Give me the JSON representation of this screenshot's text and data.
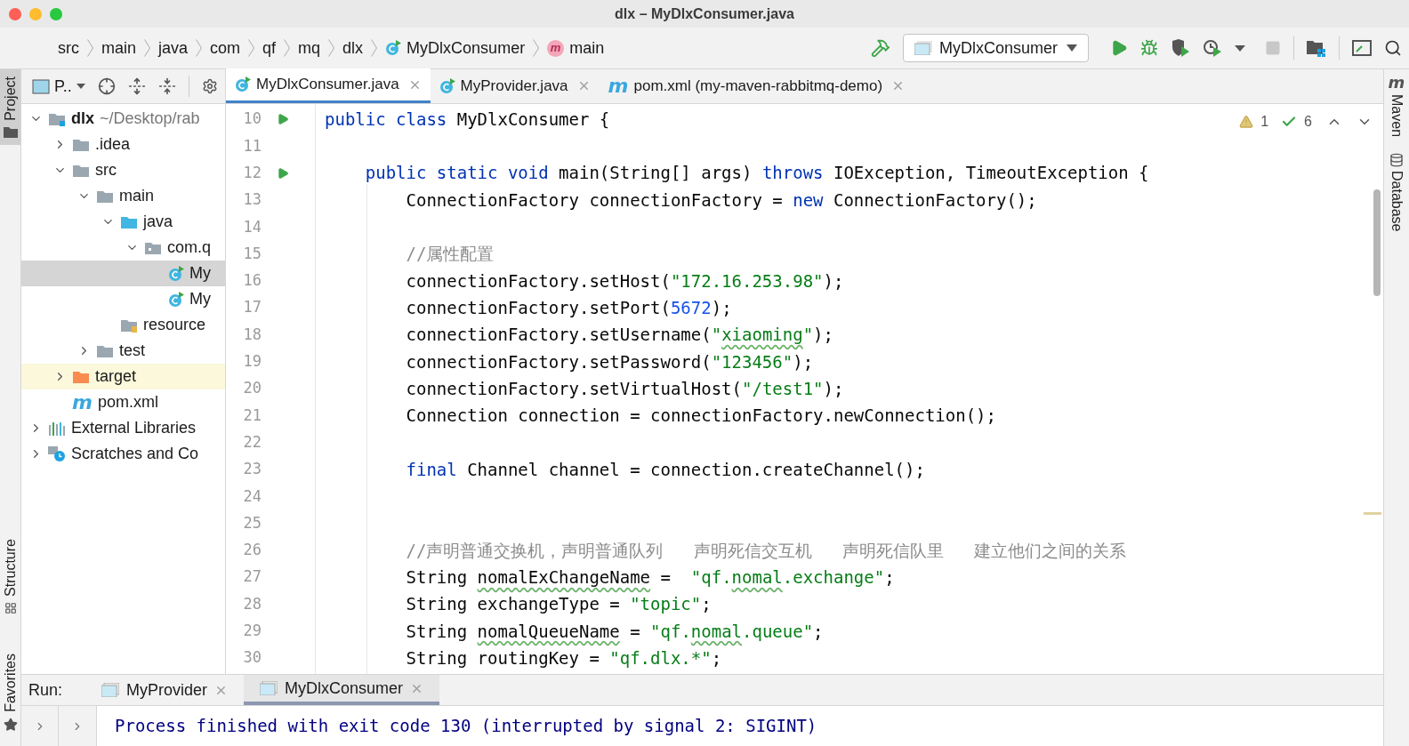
{
  "window": {
    "title": "dlx – MyDlxConsumer.java"
  },
  "breadcrumbs": [
    {
      "label": "src",
      "kind": "plain"
    },
    {
      "label": "main",
      "kind": "plain"
    },
    {
      "label": "java",
      "kind": "plain"
    },
    {
      "label": "com",
      "kind": "plain"
    },
    {
      "label": "qf",
      "kind": "plain"
    },
    {
      "label": "mq",
      "kind": "plain"
    },
    {
      "label": "dlx",
      "kind": "plain"
    },
    {
      "label": "MyDlxConsumer",
      "kind": "class"
    },
    {
      "label": "main",
      "kind": "method",
      "glyph": "m"
    }
  ],
  "run_config": {
    "label": "MyDlxConsumer"
  },
  "project_panel": {
    "view_label": "P..",
    "tree": [
      {
        "name": "dlx",
        "detail": "~/Desktop/rab",
        "kind": "module",
        "expanded": true,
        "selected": false,
        "children": [
          {
            "name": ".idea",
            "kind": "folder",
            "expanded": false,
            "selected": false
          },
          {
            "name": "src",
            "kind": "folder",
            "expanded": true,
            "selected": false,
            "children": [
              {
                "name": "main",
                "kind": "folder",
                "expanded": true,
                "selected": false,
                "children": [
                  {
                    "name": "java",
                    "kind": "source-folder",
                    "expanded": true,
                    "selected": false,
                    "children": [
                      {
                        "name": "com.q",
                        "kind": "package",
                        "expanded": true,
                        "selected": false,
                        "children": [
                          {
                            "name": "My",
                            "kind": "class",
                            "expanded": false,
                            "selected": true
                          },
                          {
                            "name": "My",
                            "kind": "class",
                            "expanded": false,
                            "selected": false
                          }
                        ]
                      }
                    ]
                  },
                  {
                    "name": "resource",
                    "kind": "resources-folder",
                    "expanded": false,
                    "selected": false
                  }
                ]
              },
              {
                "name": "test",
                "kind": "folder",
                "expanded": false,
                "selected": false
              }
            ]
          },
          {
            "name": "target",
            "kind": "excluded-folder",
            "expanded": false,
            "selected": false
          },
          {
            "name": "pom.xml",
            "kind": "maven",
            "glyph": "m",
            "expanded": false,
            "selected": false
          }
        ]
      },
      {
        "name": "External Libraries",
        "kind": "libraries",
        "expanded": false,
        "selected": false
      },
      {
        "name": "Scratches and Co",
        "kind": "scratches",
        "expanded": false,
        "selected": false
      }
    ]
  },
  "editor_tabs": [
    {
      "label": "MyDlxConsumer.java",
      "kind": "class",
      "selected": true
    },
    {
      "label": "MyProvider.java",
      "kind": "class",
      "selected": false
    },
    {
      "label": "pom.xml (my-maven-rabbitmq-demo)",
      "kind": "maven",
      "glyph": "m",
      "selected": false
    }
  ],
  "inspections": {
    "warnings": "1",
    "checks": "6"
  },
  "code_lines": [
    {
      "number": "10",
      "run_marker": true,
      "tokens": [
        {
          "kind": "keyword",
          "text": "public class"
        },
        {
          "kind": "plain",
          "text": " MyDlxConsumer {"
        }
      ],
      "children": [
        {
          "number": "11",
          "run_marker": false
        },
        {
          "number": "12",
          "run_marker": true,
          "tokens": [
            {
              "kind": "keyword",
              "text": "public static void"
            },
            {
              "kind": "plain",
              "text": " main(String[] args) "
            },
            {
              "kind": "keyword",
              "text": "throws"
            },
            {
              "kind": "plain",
              "text": " IOException, TimeoutException {"
            }
          ],
          "children": [
            {
              "number": "13",
              "run_marker": false,
              "tokens": [
                {
                  "kind": "plain",
                  "text": "ConnectionFactory connectionFactory = "
                },
                {
                  "kind": "keyword",
                  "text": "new"
                },
                {
                  "kind": "plain",
                  "text": " ConnectionFactory();"
                }
              ]
            },
            {
              "number": "14",
              "run_marker": false
            },
            {
              "number": "15",
              "run_marker": false,
              "tokens": [
                {
                  "kind": "comment",
                  "text": "//属性配置"
                }
              ]
            },
            {
              "number": "16",
              "run_marker": false,
              "tokens": [
                {
                  "kind": "plain",
                  "text": "connectionFactory.setHost("
                },
                {
                  "kind": "string",
                  "text": "\"172.16.253.98\""
                },
                {
                  "kind": "plain",
                  "text": ");"
                }
              ]
            },
            {
              "number": "17",
              "run_marker": false,
              "tokens": [
                {
                  "kind": "plain",
                  "text": "connectionFactory.setPort("
                },
                {
                  "kind": "number",
                  "text": "5672"
                },
                {
                  "kind": "plain",
                  "text": ");"
                }
              ]
            },
            {
              "number": "18",
              "run_marker": false,
              "tokens": [
                {
                  "kind": "plain",
                  "text": "connectionFactory.setUsername("
                },
                {
                  "kind": "string",
                  "text": "\""
                },
                {
                  "kind": "string-typo",
                  "text": "xiaoming"
                },
                {
                  "kind": "string",
                  "text": "\""
                },
                {
                  "kind": "plain",
                  "text": ");"
                }
              ]
            },
            {
              "number": "19",
              "run_marker": false,
              "tokens": [
                {
                  "kind": "plain",
                  "text": "connectionFactory.setPassword("
                },
                {
                  "kind": "string",
                  "text": "\"123456\""
                },
                {
                  "kind": "plain",
                  "text": ");"
                }
              ]
            },
            {
              "number": "20",
              "run_marker": false,
              "tokens": [
                {
                  "kind": "plain",
                  "text": "connectionFactory.setVirtualHost("
                },
                {
                  "kind": "string",
                  "text": "\"/test1\""
                },
                {
                  "kind": "plain",
                  "text": ");"
                }
              ]
            },
            {
              "number": "21",
              "run_marker": false,
              "tokens": [
                {
                  "kind": "plain",
                  "text": "Connection connection = connectionFactory.newConnection();"
                }
              ]
            },
            {
              "number": "22",
              "run_marker": false
            },
            {
              "number": "23",
              "run_marker": false,
              "tokens": [
                {
                  "kind": "keyword",
                  "text": "final"
                },
                {
                  "kind": "plain",
                  "text": " Channel channel = connection.createChannel();"
                }
              ]
            },
            {
              "number": "24",
              "run_marker": false
            },
            {
              "number": "25",
              "run_marker": false
            },
            {
              "number": "26",
              "run_marker": false,
              "tokens": [
                {
                  "kind": "comment",
                  "text": "//声明普通交换机，声明普通队列   声明死信交互机   声明死信队里   建立他们之间的关系"
                }
              ]
            },
            {
              "number": "27",
              "run_marker": false,
              "tokens": [
                {
                  "kind": "plain",
                  "text": "String "
                },
                {
                  "kind": "plain-typo",
                  "text": "nomalExChangeName"
                },
                {
                  "kind": "plain",
                  "text": " =  "
                },
                {
                  "kind": "string",
                  "text": "\"qf."
                },
                {
                  "kind": "string-typo",
                  "text": "nomal"
                },
                {
                  "kind": "string",
                  "text": ".exchange\""
                },
                {
                  "kind": "plain",
                  "text": ";"
                }
              ]
            },
            {
              "number": "28",
              "run_marker": false,
              "tokens": [
                {
                  "kind": "plain",
                  "text": "String exchangeType = "
                },
                {
                  "kind": "string",
                  "text": "\"topic\""
                },
                {
                  "kind": "plain",
                  "text": ";"
                }
              ]
            },
            {
              "number": "29",
              "run_marker": false,
              "tokens": [
                {
                  "kind": "plain",
                  "text": "String "
                },
                {
                  "kind": "plain-typo",
                  "text": "nomalQueueName"
                },
                {
                  "kind": "plain",
                  "text": " = "
                },
                {
                  "kind": "string",
                  "text": "\"qf."
                },
                {
                  "kind": "string-typo",
                  "text": "nomal"
                },
                {
                  "kind": "string",
                  "text": ".queue\""
                },
                {
                  "kind": "plain",
                  "text": ";"
                }
              ]
            },
            {
              "number": "30",
              "run_marker": false,
              "tokens": [
                {
                  "kind": "plain",
                  "text": "String routingKey = "
                },
                {
                  "kind": "string",
                  "text": "\"qf.dlx.*\""
                },
                {
                  "kind": "plain",
                  "text": ";"
                }
              ]
            }
          ]
        }
      ]
    }
  ],
  "run_panel": {
    "label": "Run:",
    "tabs": [
      {
        "label": "MyProvider",
        "selected": false
      },
      {
        "label": "MyDlxConsumer",
        "selected": true
      }
    ],
    "console_line": "Process finished with exit code 130 (interrupted by signal 2: SIGINT)"
  },
  "left_stripe": [
    {
      "label": "Project",
      "kind": "project",
      "selected": true
    },
    {
      "label": "Structure",
      "kind": "structure",
      "selected": false
    },
    {
      "label": "Favorites",
      "kind": "favorites",
      "selected": false
    }
  ],
  "right_stripe": [
    {
      "label": "Maven",
      "kind": "maven",
      "glyph": "m"
    },
    {
      "label": "Database",
      "kind": "database"
    }
  ]
}
